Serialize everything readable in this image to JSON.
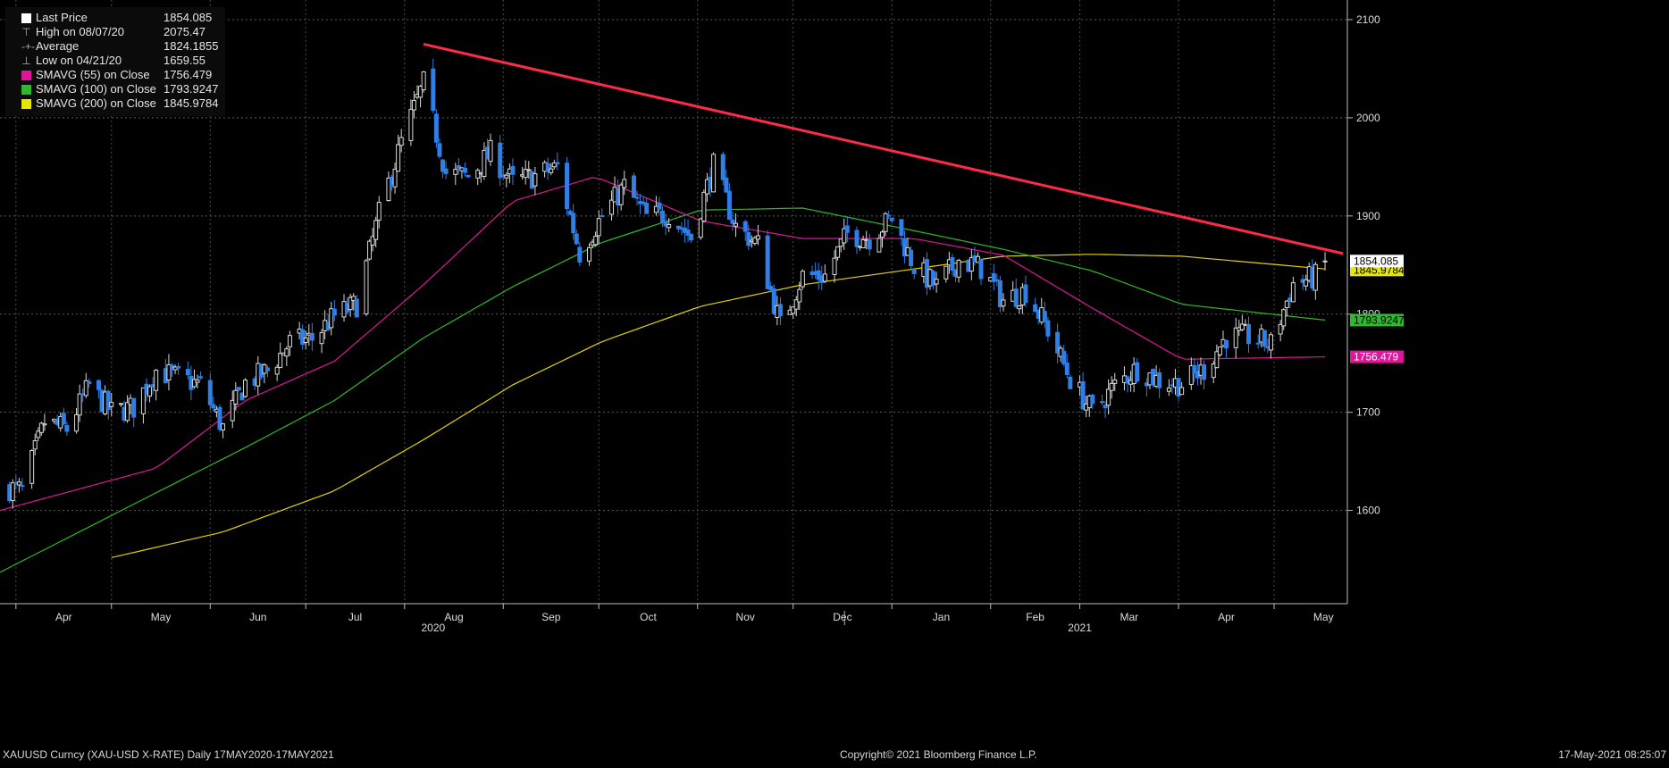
{
  "legend": [
    {
      "label": "Last Price",
      "value": "1854.085",
      "swatch": "#ffffff",
      "icon": "square-icon"
    },
    {
      "label": "High on 08/07/20",
      "value": "2075.47",
      "swatch": null,
      "icon": "high-marker-icon"
    },
    {
      "label": "Average",
      "value": "1824.1855",
      "swatch": null,
      "icon": "average-marker-icon"
    },
    {
      "label": "Low on 04/21/20",
      "value": "1659.55",
      "swatch": null,
      "icon": "low-marker-icon"
    },
    {
      "label": "SMAVG (55)  on Close",
      "value": "1756.479",
      "swatch": "#e0169a",
      "icon": "square-icon"
    },
    {
      "label": "SMAVG (100)  on Close",
      "value": "1793.9247",
      "swatch": "#2db82d",
      "icon": "square-icon"
    },
    {
      "label": "SMAVG (200)  on Close",
      "value": "1845.9784",
      "swatch": "#e6e600",
      "icon": "square-icon"
    }
  ],
  "footer": {
    "left": "XAUUSD Curncy (XAU-USD X-RATE)  Daily 17MAY2020-17MAY2021",
    "center": "Copyright© 2021 Bloomberg Finance L.P.",
    "right": "17-May-2021 08:25:07"
  },
  "colors": {
    "up_candle": "#d9d9d9",
    "down_candle": "#2f7fe8",
    "sma55": "#e0169a",
    "sma100": "#2db82d",
    "sma200": "#e6d200",
    "trendline": "#ff2a4a",
    "last_price_tag": "#ffffff"
  },
  "chart_data": {
    "type": "candlestick",
    "title": "",
    "y_ticks": [
      1600,
      1700,
      1800,
      1900,
      2000,
      2100
    ],
    "y_tick_labels": [
      "1600",
      "1700",
      "1800",
      "1900",
      "2000",
      "2100"
    ],
    "ylim": [
      1505,
      2120
    ],
    "x_month_labels": [
      "Apr",
      "May",
      "Jun",
      "Jul",
      "Aug",
      "Sep",
      "Oct",
      "Nov",
      "Dec",
      "Jan",
      "Feb",
      "Mar",
      "Apr",
      "May"
    ],
    "x_year_labels": [
      "2020",
      "2021"
    ],
    "last_value_tags": [
      {
        "text": "1854.085",
        "value": 1854.085,
        "color": "#ffffff",
        "text_color": "#000000"
      },
      {
        "text": "1845.9784",
        "value": 1845.9784,
        "color": "#e6e600",
        "text_color": "#000000"
      },
      {
        "text": "1793.9247",
        "value": 1793.9247,
        "color": "#2db82d",
        "text_color": "#000000"
      },
      {
        "text": "1756.479",
        "value": 1756.479,
        "color": "#e0169a",
        "text_color": "#ffffff"
      }
    ],
    "weekly_closes": [
      {
        "date": "2020-03-27",
        "close": 1625
      },
      {
        "date": "2020-04-03",
        "close": 1620
      },
      {
        "date": "2020-04-10",
        "close": 1690
      },
      {
        "date": "2020-04-17",
        "close": 1683
      },
      {
        "date": "2020-04-24",
        "close": 1727
      },
      {
        "date": "2020-05-01",
        "close": 1700
      },
      {
        "date": "2020-05-08",
        "close": 1705
      },
      {
        "date": "2020-05-15",
        "close": 1743
      },
      {
        "date": "2020-05-22",
        "close": 1735
      },
      {
        "date": "2020-05-29",
        "close": 1728
      },
      {
        "date": "2020-06-05",
        "close": 1684
      },
      {
        "date": "2020-06-12",
        "close": 1730
      },
      {
        "date": "2020-06-19",
        "close": 1742
      },
      {
        "date": "2020-06-26",
        "close": 1771
      },
      {
        "date": "2020-07-03",
        "close": 1775
      },
      {
        "date": "2020-07-10",
        "close": 1798
      },
      {
        "date": "2020-07-17",
        "close": 1810
      },
      {
        "date": "2020-07-24",
        "close": 1902
      },
      {
        "date": "2020-07-31",
        "close": 1975
      },
      {
        "date": "2020-08-07",
        "close": 2035
      },
      {
        "date": "2020-08-14",
        "close": 1944
      },
      {
        "date": "2020-08-21",
        "close": 1940
      },
      {
        "date": "2020-08-28",
        "close": 1964
      },
      {
        "date": "2020-09-04",
        "close": 1934
      },
      {
        "date": "2020-09-11",
        "close": 1941
      },
      {
        "date": "2020-09-18",
        "close": 1950
      },
      {
        "date": "2020-09-25",
        "close": 1862
      },
      {
        "date": "2020-10-02",
        "close": 1900
      },
      {
        "date": "2020-10-09",
        "close": 1930
      },
      {
        "date": "2020-10-16",
        "close": 1899
      },
      {
        "date": "2020-10-23",
        "close": 1902
      },
      {
        "date": "2020-10-30",
        "close": 1878
      },
      {
        "date": "2020-11-06",
        "close": 1951
      },
      {
        "date": "2020-11-13",
        "close": 1889
      },
      {
        "date": "2020-11-20",
        "close": 1871
      },
      {
        "date": "2020-11-27",
        "close": 1788
      },
      {
        "date": "2020-12-04",
        "close": 1839
      },
      {
        "date": "2020-12-11",
        "close": 1839
      },
      {
        "date": "2020-12-18",
        "close": 1882
      },
      {
        "date": "2020-12-25",
        "close": 1878
      },
      {
        "date": "2021-01-01",
        "close": 1898
      },
      {
        "date": "2021-01-08",
        "close": 1849
      },
      {
        "date": "2021-01-15",
        "close": 1828
      },
      {
        "date": "2021-01-22",
        "close": 1855
      },
      {
        "date": "2021-01-29",
        "close": 1847
      },
      {
        "date": "2021-02-05",
        "close": 1814
      },
      {
        "date": "2021-02-12",
        "close": 1824
      },
      {
        "date": "2021-02-19",
        "close": 1784
      },
      {
        "date": "2021-02-26",
        "close": 1734
      },
      {
        "date": "2021-03-05",
        "close": 1700
      },
      {
        "date": "2021-03-12",
        "close": 1727
      },
      {
        "date": "2021-03-19",
        "close": 1745
      },
      {
        "date": "2021-03-26",
        "close": 1732
      },
      {
        "date": "2021-04-02",
        "close": 1729
      },
      {
        "date": "2021-04-09",
        "close": 1744
      },
      {
        "date": "2021-04-16",
        "close": 1777
      },
      {
        "date": "2021-04-23",
        "close": 1777
      },
      {
        "date": "2021-04-30",
        "close": 1769
      },
      {
        "date": "2021-05-07",
        "close": 1831
      },
      {
        "date": "2021-05-14",
        "close": 1838
      },
      {
        "date": "2021-05-17",
        "close": 1854.085
      }
    ],
    "sma55": [
      {
        "date": "2020-03-27",
        "value": 1600
      },
      {
        "date": "2020-05-15",
        "value": 1643
      },
      {
        "date": "2020-06-12",
        "value": 1712
      },
      {
        "date": "2020-07-10",
        "value": 1752
      },
      {
        "date": "2020-08-07",
        "value": 1830
      },
      {
        "date": "2020-09-04",
        "value": 1915
      },
      {
        "date": "2020-09-30",
        "value": 1940
      },
      {
        "date": "2020-11-02",
        "value": 1895
      },
      {
        "date": "2020-12-04",
        "value": 1877
      },
      {
        "date": "2021-01-08",
        "value": 1877
      },
      {
        "date": "2021-02-05",
        "value": 1860
      },
      {
        "date": "2021-03-05",
        "value": 1806
      },
      {
        "date": "2021-04-02",
        "value": 1754
      },
      {
        "date": "2021-05-17",
        "value": 1756.479
      }
    ],
    "sma100": [
      {
        "date": "2020-03-27",
        "value": 1537
      },
      {
        "date": "2020-05-15",
        "value": 1618
      },
      {
        "date": "2020-06-12",
        "value": 1664
      },
      {
        "date": "2020-07-10",
        "value": 1712
      },
      {
        "date": "2020-08-07",
        "value": 1776
      },
      {
        "date": "2020-09-04",
        "value": 1828
      },
      {
        "date": "2020-10-02",
        "value": 1873
      },
      {
        "date": "2020-11-02",
        "value": 1906
      },
      {
        "date": "2020-12-04",
        "value": 1908
      },
      {
        "date": "2021-01-08",
        "value": 1885
      },
      {
        "date": "2021-02-05",
        "value": 1866
      },
      {
        "date": "2021-03-05",
        "value": 1844
      },
      {
        "date": "2021-04-02",
        "value": 1810
      },
      {
        "date": "2021-05-17",
        "value": 1793.9247
      }
    ],
    "sma200": [
      {
        "date": "2020-05-01",
        "value": 1552
      },
      {
        "date": "2020-06-05",
        "value": 1578
      },
      {
        "date": "2020-07-10",
        "value": 1620
      },
      {
        "date": "2020-08-07",
        "value": 1672
      },
      {
        "date": "2020-09-04",
        "value": 1728
      },
      {
        "date": "2020-10-02",
        "value": 1772
      },
      {
        "date": "2020-11-02",
        "value": 1808
      },
      {
        "date": "2020-12-04",
        "value": 1830
      },
      {
        "date": "2021-01-08",
        "value": 1846
      },
      {
        "date": "2021-02-05",
        "value": 1859
      },
      {
        "date": "2021-03-05",
        "value": 1861
      },
      {
        "date": "2021-04-02",
        "value": 1859
      },
      {
        "date": "2021-05-17",
        "value": 1845.9784
      }
    ],
    "trendline": [
      {
        "date": "2020-08-07",
        "value": 2075
      },
      {
        "date": "2021-05-17",
        "value": 1859
      }
    ]
  }
}
